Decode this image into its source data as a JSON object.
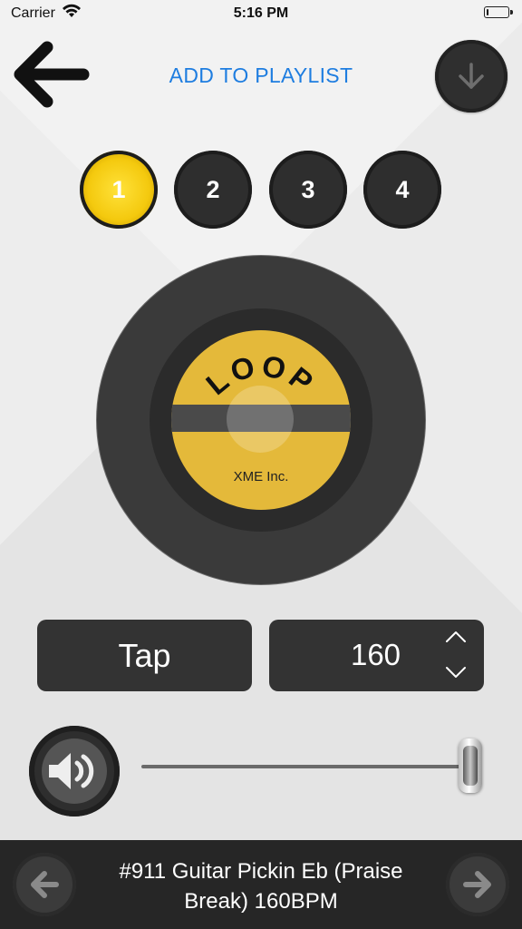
{
  "status_bar": {
    "carrier": "Carrier",
    "time": "5:16 PM",
    "battery_level": 0.1
  },
  "header": {
    "back_icon": "arrow-left-icon",
    "add_to_playlist_label": "ADD TO PLAYLIST",
    "download_icon": "arrow-down-icon",
    "link_color": "#1e7de0"
  },
  "slots": [
    {
      "label": "1",
      "active": true
    },
    {
      "label": "2",
      "active": false
    },
    {
      "label": "3",
      "active": false
    },
    {
      "label": "4",
      "active": false
    }
  ],
  "record": {
    "title": "LOOP",
    "maker": "XME Inc.",
    "label_color": "#e4b93a"
  },
  "tempo": {
    "tap_label": "Tap",
    "bpm_value": "160",
    "increment_icon": "chevron-up-icon",
    "decrement_icon": "chevron-down-icon"
  },
  "volume": {
    "icon": "speaker-icon",
    "level": 1.0
  },
  "now_playing": {
    "title": "#911 Guitar Pickin Eb (Praise Break) 160BPM",
    "prev_icon": "arrow-left-icon",
    "next_icon": "arrow-right-icon"
  }
}
